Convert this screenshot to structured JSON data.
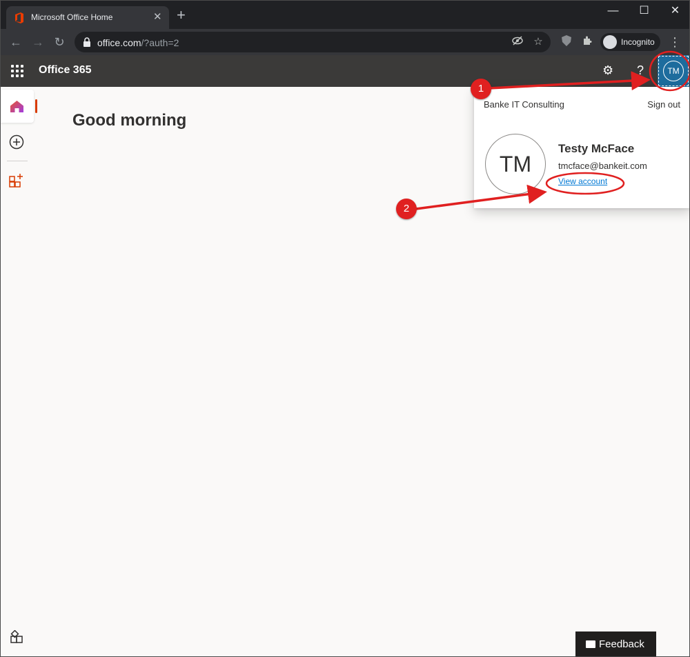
{
  "browser": {
    "tab_title": "Microsoft Office Home",
    "url_host": "office.com",
    "url_path": "/?auth=2",
    "incognito_label": "Incognito"
  },
  "header": {
    "app_name": "Office 365",
    "avatar_initials": "TM"
  },
  "main": {
    "greeting": "Good morning"
  },
  "account_flyout": {
    "organization": "Banke IT Consulting",
    "sign_out": "Sign out",
    "avatar_initials": "TM",
    "user_name": "Testy McFace",
    "user_email": "tmcface@bankeit.com",
    "view_account": "View account"
  },
  "annotations": {
    "badge_1": "1",
    "badge_2": "2",
    "color": "#e02020"
  },
  "footer": {
    "feedback": "Feedback"
  },
  "colors": {
    "office_header": "#3b3a39",
    "avatar_bg": "#1d6c9d",
    "accent_orange": "#d83b01",
    "link_blue": "#0078d4"
  }
}
